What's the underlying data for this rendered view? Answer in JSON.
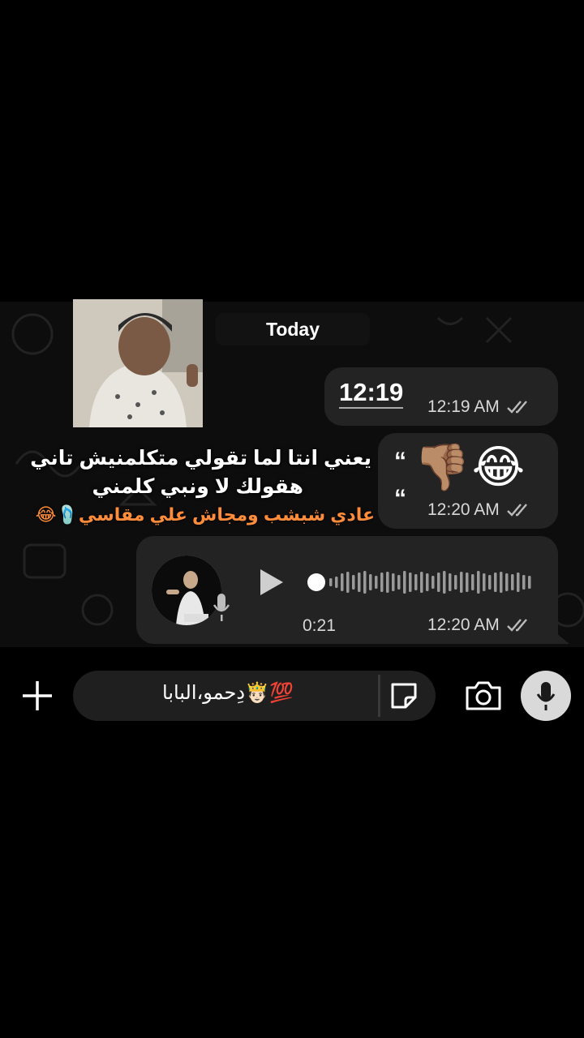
{
  "chat": {
    "day_label": "Today",
    "messages": [
      {
        "text": "12:19",
        "time": "12:19 AM"
      },
      {
        "emojis": "👎🏽😂",
        "time": "12:20 AM"
      },
      {
        "type": "voice",
        "duration": "0:21",
        "time": "12:20 AM"
      }
    ],
    "quote_open": "“",
    "quote_close": "“"
  },
  "overlay": {
    "line1": "يعني انتا لما تقولي متكلمنيش تاني",
    "line2": "هقولك لا ونبي كلمني",
    "line3": "عادي شبشب ومجاش علي مقاسي🩴😂"
  },
  "input": {
    "text": "دِحمو،البابا🤴🏻💯"
  },
  "icons": {
    "plus": "plus-icon",
    "sticker": "sticker-icon",
    "camera": "camera-icon",
    "mic": "mic-icon",
    "play": "play-icon",
    "read_ticks": "double-check-icon"
  }
}
